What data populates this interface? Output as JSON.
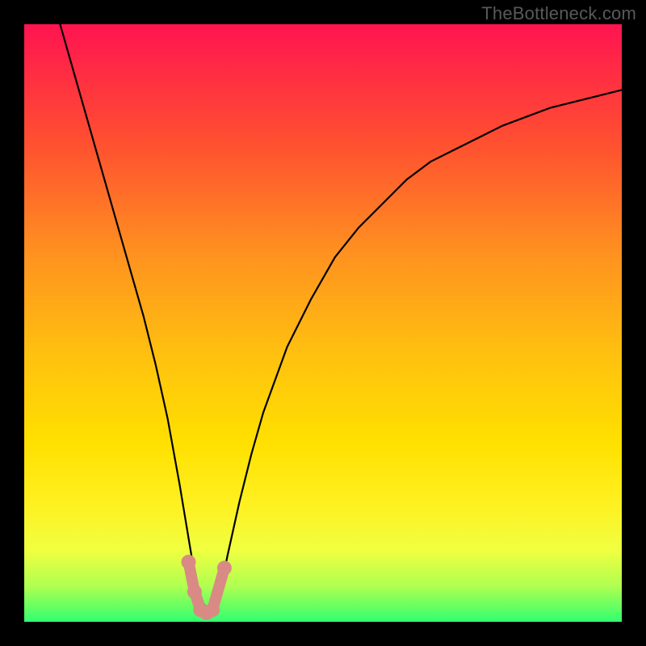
{
  "watermark": "TheBottleneck.com",
  "colors": {
    "border": "#000000",
    "curve": "#000000",
    "marker_fill": "#d98a84",
    "marker_stroke": "#b06a64",
    "grad_top": "#ff1450",
    "grad_1": "#ff5030",
    "grad_2": "#ff9020",
    "grad_3": "#ffc010",
    "grad_4": "#ffe000",
    "grad_5": "#fff020",
    "grad_6": "#f0ff40",
    "grad_7": "#b0ff50",
    "grad_bottom": "#30ff70"
  },
  "layout": {
    "outer": 800,
    "inner_x": 30,
    "inner_y": 30,
    "inner_w": 740,
    "inner_h": 740
  },
  "chart_data": {
    "type": "line",
    "title": "",
    "xlabel": "",
    "ylabel": "",
    "xlim": [
      0,
      100
    ],
    "ylim": [
      0,
      100
    ],
    "notes": "V-shaped bottleneck curve over a vertical red→green heat gradient. Y axis reads top=high bottleneck, bottom=low. Minimum near x≈29–33.",
    "series": [
      {
        "name": "bottleneck-curve",
        "x": [
          6,
          8,
          10,
          12,
          14,
          16,
          18,
          20,
          22,
          24,
          26,
          27,
          28,
          29,
          30,
          31,
          32,
          33,
          34,
          36,
          38,
          40,
          44,
          48,
          52,
          56,
          60,
          64,
          68,
          72,
          76,
          80,
          84,
          88,
          92,
          96,
          100
        ],
        "y": [
          100,
          93,
          86,
          79,
          72,
          65,
          58,
          51,
          43,
          34,
          23,
          17,
          11,
          6,
          3,
          2,
          3,
          6,
          11,
          20,
          28,
          35,
          46,
          54,
          61,
          66,
          70,
          74,
          77,
          79,
          81,
          83,
          84.5,
          86,
          87,
          88,
          89
        ]
      }
    ],
    "markers": [
      {
        "name": "left-knee-top",
        "x": 27.5,
        "y": 10
      },
      {
        "name": "left-knee-bot",
        "x": 28.5,
        "y": 5
      },
      {
        "name": "trough-left",
        "x": 29.5,
        "y": 2
      },
      {
        "name": "trough-mid",
        "x": 30.5,
        "y": 1.5
      },
      {
        "name": "trough-right",
        "x": 31.5,
        "y": 2
      },
      {
        "name": "right-knee",
        "x": 33.5,
        "y": 9
      }
    ]
  }
}
